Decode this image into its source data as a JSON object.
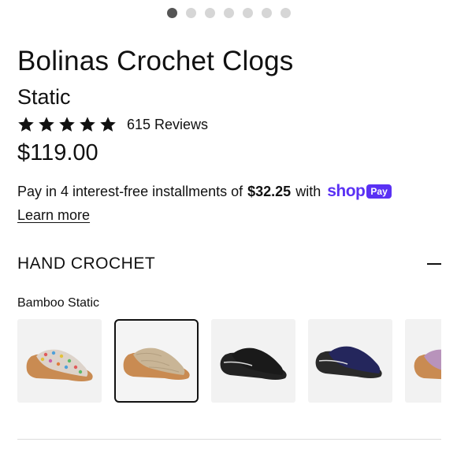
{
  "carousel": {
    "total_slides": 7,
    "active_index": 0
  },
  "product": {
    "title": "Bolinas Crochet Clogs",
    "color_name": "Static",
    "rating": {
      "stars": 5,
      "max": 5,
      "reviews_text": "615 Reviews"
    },
    "price": "$119.00"
  },
  "payment": {
    "prefix": "Pay in 4 interest-free installments of",
    "amount": "$32.25",
    "suffix": "with",
    "shop_word": "shop",
    "pay_badge": "Pay",
    "learn_more": "Learn more"
  },
  "section": {
    "title": "HAND CROCHET",
    "icon": "minus-icon"
  },
  "variants": {
    "selected_label": "Bamboo Static",
    "swatches": [
      {
        "name": "static",
        "color": "#d9cfc6",
        "dots": true
      },
      {
        "name": "bamboo-static",
        "color": "#c8b396",
        "selected": true
      },
      {
        "name": "black",
        "color": "#1c1c1c"
      },
      {
        "name": "navy",
        "color": "#23245a"
      },
      {
        "name": "purple",
        "color": "#b58fb8"
      }
    ]
  },
  "colors": {
    "shop_pay": "#5a31f4",
    "star": "#111111",
    "dot_active": "#555555",
    "dot_inactive": "#d6d6d6"
  }
}
